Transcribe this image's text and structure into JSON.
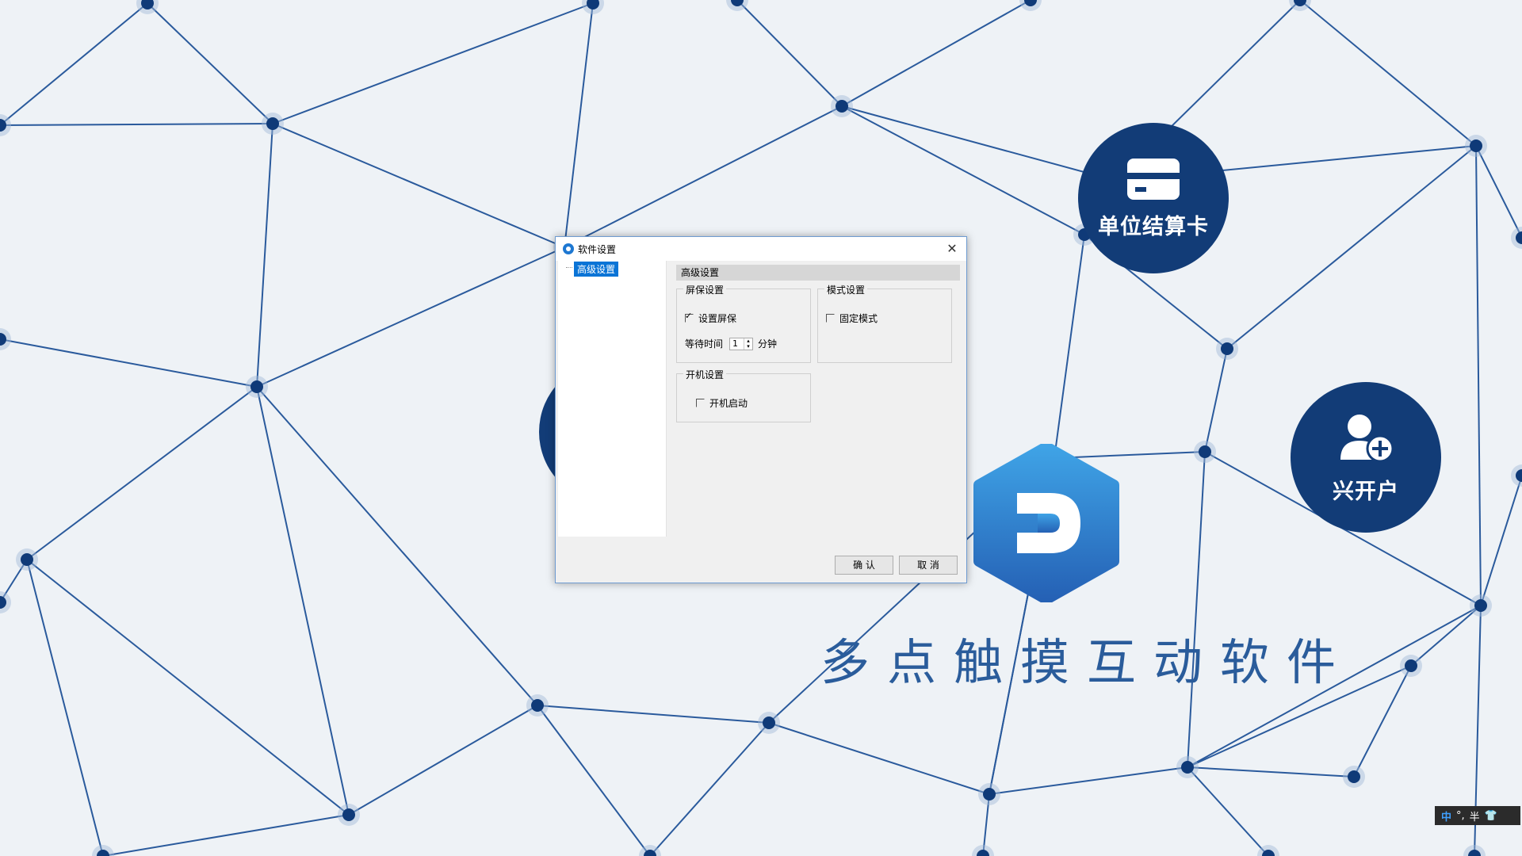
{
  "desktop": {
    "app_title": "多点触摸互动软件",
    "features": {
      "card_label": "单位结算卡",
      "account_label": "兴开户"
    }
  },
  "dialog": {
    "title": "软件设置",
    "tree_item": "高级设置",
    "section_header": "高级设置",
    "screensaver": {
      "group_title": "屏保设置",
      "enable_label": "设置屏保",
      "enable_checked": true,
      "wait_label": "等待时间",
      "wait_value": "1",
      "wait_unit": "分钟"
    },
    "mode": {
      "group_title": "模式设置",
      "fixed_label": "固定模式",
      "fixed_checked": false
    },
    "startup": {
      "group_title": "开机设置",
      "autostart_label": "开机启动",
      "autostart_checked": false
    },
    "ok_label": "确 认",
    "cancel_label": "取 消"
  },
  "taskbar": {
    "ime_mode": "中",
    "ime_punct": "°,",
    "ime_width": "半"
  },
  "colors": {
    "desktop_bg": "#eef2f6",
    "network_line": "#2a5a9c",
    "node": "#0f3a78",
    "feature_circle": "#123c77",
    "logo_blue": "#3a8fd8",
    "selection": "#0a74d6"
  },
  "icons": [
    "card-icon",
    "add-user-icon",
    "app-logo-icon",
    "close-icon",
    "app-icon",
    "shirt-icon"
  ]
}
